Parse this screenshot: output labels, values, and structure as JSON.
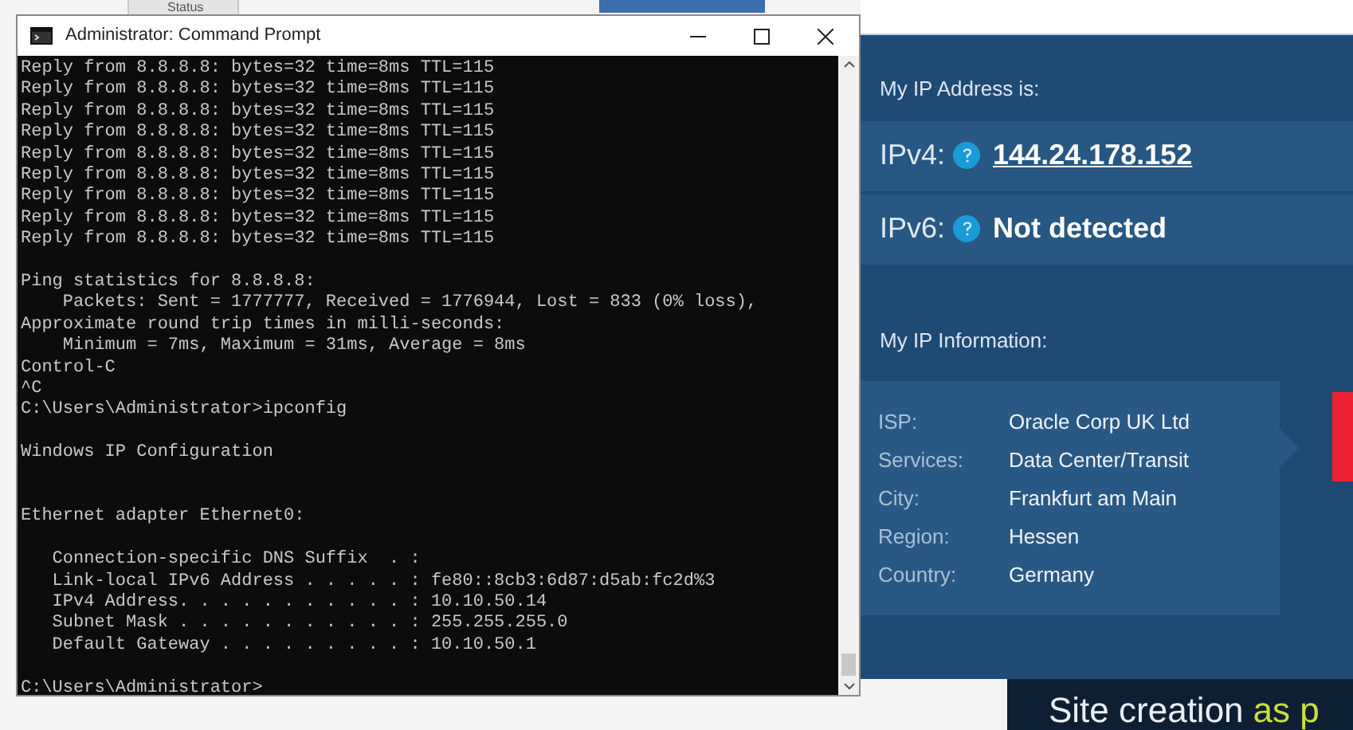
{
  "background_tab": {
    "label": "Status"
  },
  "window": {
    "title": "Administrator: Command Prompt"
  },
  "console": {
    "lines": [
      {
        "kind": "output",
        "text": "Reply from 8.8.8.8: bytes=32 time=8ms TTL=115"
      },
      {
        "kind": "output",
        "text": "Reply from 8.8.8.8: bytes=32 time=8ms TTL=115"
      },
      {
        "kind": "output",
        "text": "Reply from 8.8.8.8: bytes=32 time=8ms TTL=115"
      },
      {
        "kind": "output",
        "text": "Reply from 8.8.8.8: bytes=32 time=8ms TTL=115"
      },
      {
        "kind": "output",
        "text": "Reply from 8.8.8.8: bytes=32 time=8ms TTL=115"
      },
      {
        "kind": "output",
        "text": "Reply from 8.8.8.8: bytes=32 time=8ms TTL=115"
      },
      {
        "kind": "output",
        "text": "Reply from 8.8.8.8: bytes=32 time=8ms TTL=115"
      },
      {
        "kind": "output",
        "text": "Reply from 8.8.8.8: bytes=32 time=8ms TTL=115"
      },
      {
        "kind": "output",
        "text": "Reply from 8.8.8.8: bytes=32 time=8ms TTL=115"
      },
      {
        "kind": "blank"
      },
      {
        "kind": "output",
        "text": "Ping statistics for 8.8.8.8:"
      },
      {
        "kind": "output",
        "text": "    Packets: Sent = 1777777, Received = 1776944, Lost = 833 (0% loss),"
      },
      {
        "kind": "output",
        "text": "Approximate round trip times in milli-seconds:"
      },
      {
        "kind": "output",
        "text": "    Minimum = 7ms, Maximum = 31ms, Average = 8ms"
      },
      {
        "kind": "output",
        "text": "Control-C"
      },
      {
        "kind": "output",
        "text": "^C"
      },
      {
        "kind": "output",
        "text": "C:\\Users\\Administrator>ipconfig"
      },
      {
        "kind": "blank"
      },
      {
        "kind": "output",
        "text": "Windows IP Configuration"
      },
      {
        "kind": "blank"
      },
      {
        "kind": "blank"
      },
      {
        "kind": "output",
        "text": "Ethernet adapter Ethernet0:"
      },
      {
        "kind": "blank"
      },
      {
        "kind": "output",
        "text": "   Connection-specific DNS Suffix  . :"
      },
      {
        "kind": "output",
        "text": "   Link-local IPv6 Address . . . . . : fe80::8cb3:6d87:d5ab:fc2d%3"
      },
      {
        "kind": "output",
        "text": "   IPv4 Address. . . . . . . . . . . : 10.10.50.14"
      },
      {
        "kind": "output",
        "text": "   Subnet Mask . . . . . . . . . . . : 255.255.255.0"
      },
      {
        "kind": "output",
        "text": "   Default Gateway . . . . . . . . . : 10.10.50.1"
      },
      {
        "kind": "blank"
      },
      {
        "kind": "prompt",
        "text": "C:\\Users\\Administrator>"
      }
    ]
  },
  "ip_panel": {
    "heading": "My IP Address is:",
    "addresses": [
      {
        "label": "IPv4:",
        "value": "144.24.178.152",
        "link": true
      },
      {
        "label": "IPv6:",
        "value": "Not detected",
        "link": false
      }
    ],
    "info_heading": "My IP Information:",
    "info": [
      {
        "label": "ISP:",
        "value": "Oracle Corp UK Ltd"
      },
      {
        "label": "Services:",
        "value": "Data Center/Transit"
      },
      {
        "label": "City:",
        "value": "Frankfurt am Main"
      },
      {
        "label": "Region:",
        "value": "Hessen"
      },
      {
        "label": "Country:",
        "value": "Germany"
      }
    ]
  },
  "banner": {
    "text": "Site creation",
    "highlight": "as p"
  }
}
